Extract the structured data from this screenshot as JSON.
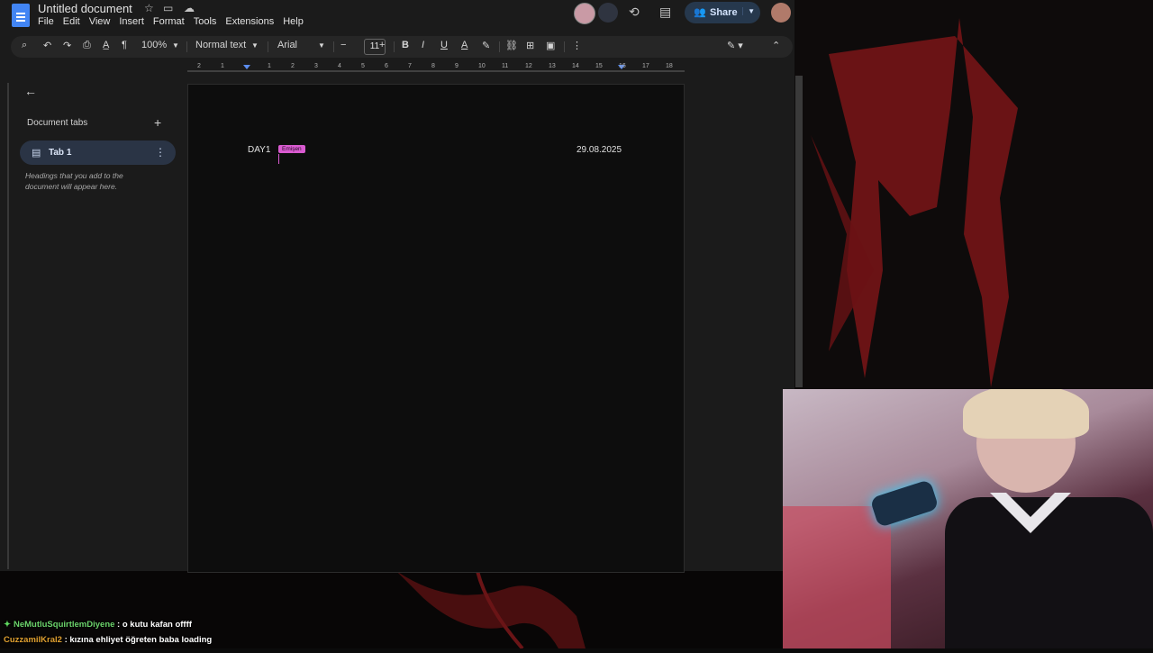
{
  "document": {
    "title": "Untitled document",
    "menu": [
      "File",
      "Edit",
      "View",
      "Insert",
      "Format",
      "Tools",
      "Extensions",
      "Help"
    ],
    "share_label": "Share"
  },
  "toolbar": {
    "zoom": "100%",
    "style": "Normal text",
    "font": "Arial",
    "font_size": "11"
  },
  "ruler": {
    "labels": [
      "2",
      "1",
      "1",
      "2",
      "3",
      "4",
      "5",
      "6",
      "7",
      "8",
      "9",
      "10",
      "11",
      "12",
      "13",
      "14",
      "15",
      "16",
      "17",
      "18"
    ]
  },
  "sidebar": {
    "heading": "Document tabs",
    "tab_label": "Tab 1",
    "hint": "Headings that you add to the document will appear here."
  },
  "page": {
    "left_text": "DAY1",
    "collaborator_flag": "Emişen",
    "right_text": "29.08.2025"
  },
  "chat": [
    {
      "user": "NeMutluSquirtlemDiyene",
      "message": " : o kutu kafan offff"
    },
    {
      "user": "CuzzamilKral2",
      "message": " : kızına ehliyet öğreten baba loading"
    }
  ],
  "colors": {
    "accent_flag": "#d95ad0",
    "share_bg": "#26384d",
    "doc_blue": "#4285f4"
  }
}
